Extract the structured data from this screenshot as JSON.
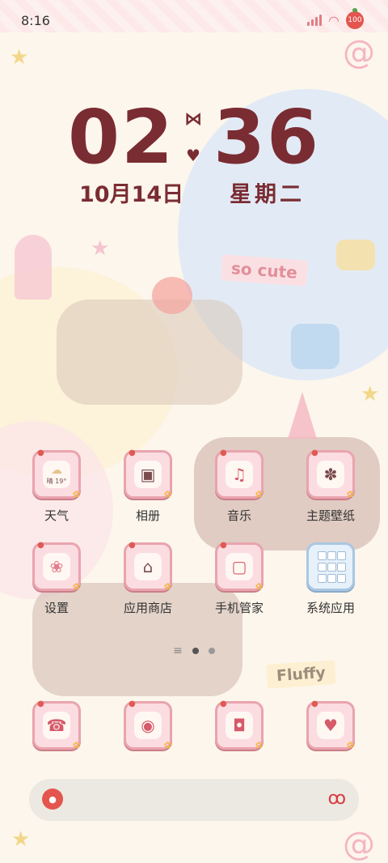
{
  "status_bar": {
    "time": "8:16",
    "battery": "100"
  },
  "clock": {
    "hours": "02",
    "minutes": "36",
    "date": "10月14日",
    "weekday": "星期二"
  },
  "stickers": {
    "so_cute": "so cute",
    "fluffy": "Fluffy"
  },
  "apps": {
    "row1": [
      {
        "label": "天气",
        "icon": "weather-icon",
        "badge": "晴 19°"
      },
      {
        "label": "相册",
        "icon": "album-icon"
      },
      {
        "label": "音乐",
        "icon": "music-icon"
      },
      {
        "label": "主题壁纸",
        "icon": "theme-wallpaper-icon"
      }
    ],
    "row2": [
      {
        "label": "设置",
        "icon": "settings-flower-icon"
      },
      {
        "label": "应用商店",
        "icon": "app-store-icon"
      },
      {
        "label": "手机管家",
        "icon": "phone-manager-icon"
      },
      {
        "label": "系统应用",
        "icon": "system-apps-folder-icon"
      }
    ],
    "dock_row": [
      {
        "icon": "phone-icon"
      },
      {
        "icon": "messages-icon"
      },
      {
        "icon": "camera-icon"
      },
      {
        "icon": "browser-icon"
      }
    ]
  },
  "colors": {
    "clock": "#7a2c33",
    "tile_pink": "#fbdce1",
    "tile_border": "#e9a4ae",
    "folder_blue": "#e7f1fb"
  }
}
